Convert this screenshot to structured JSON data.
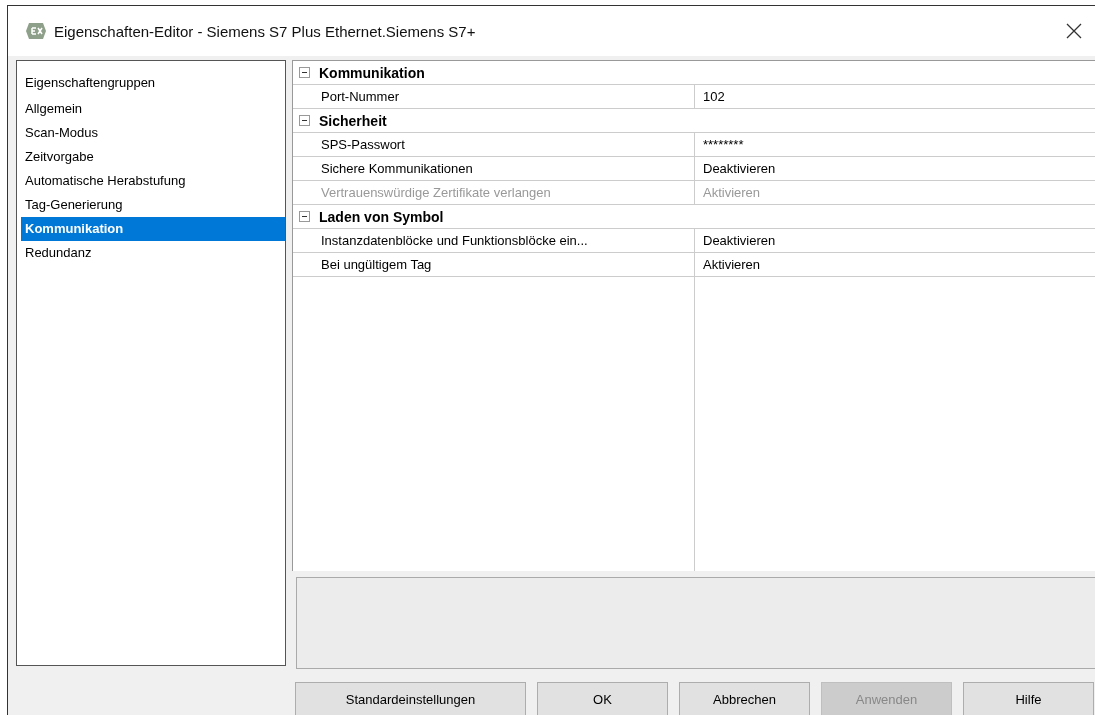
{
  "window": {
    "title": "Eigenschaften-Editor - Siemens S7 Plus Ethernet.Siemens S7+"
  },
  "sidebar": {
    "heading": "Eigenschaftengruppen",
    "items": [
      {
        "label": "Allgemein",
        "selected": false
      },
      {
        "label": "Scan-Modus",
        "selected": false
      },
      {
        "label": "Zeitvorgabe",
        "selected": false
      },
      {
        "label": "Automatische Herabstufung",
        "selected": false
      },
      {
        "label": "Tag-Generierung",
        "selected": false
      },
      {
        "label": "Kommunikation",
        "selected": true
      },
      {
        "label": "Redundanz",
        "selected": false
      }
    ]
  },
  "property_grid": {
    "categories": [
      {
        "title": "Kommunikation",
        "expanded": true,
        "properties": [
          {
            "name": "Port-Nummer",
            "value": "102",
            "disabled": false
          }
        ]
      },
      {
        "title": "Sicherheit",
        "expanded": true,
        "properties": [
          {
            "name": "SPS-Passwort",
            "value": "********",
            "disabled": false
          },
          {
            "name": "Sichere Kommunikationen",
            "value": "Deaktivieren",
            "disabled": false
          },
          {
            "name": "Vertrauenswürdige Zertifikate verlangen",
            "value": "Aktivieren",
            "disabled": true
          }
        ]
      },
      {
        "title": "Laden von Symbol",
        "expanded": true,
        "properties": [
          {
            "name": "Instanzdatenblöcke und Funktionsblöcke ein...",
            "value": "Deaktivieren",
            "disabled": false
          },
          {
            "name": "Bei ungültigem Tag",
            "value": "Aktivieren",
            "disabled": false
          }
        ]
      }
    ]
  },
  "buttons": [
    {
      "label": "Standardeinstellungen",
      "disabled": false
    },
    {
      "label": "OK",
      "disabled": false
    },
    {
      "label": "Abbrechen",
      "disabled": false
    },
    {
      "label": "Anwenden",
      "disabled": true
    },
    {
      "label": "Hilfe",
      "disabled": false
    }
  ]
}
